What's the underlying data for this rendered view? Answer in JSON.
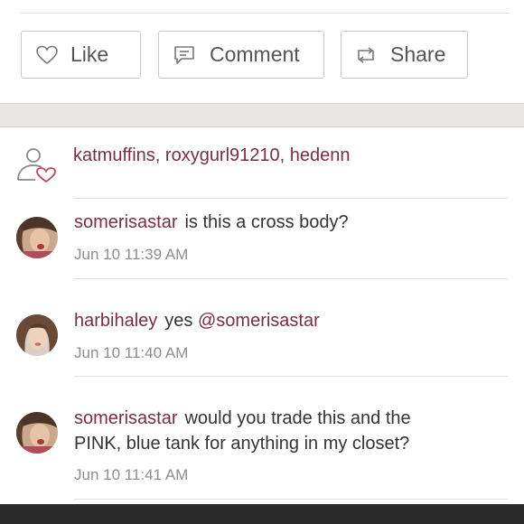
{
  "actions": {
    "like_label": "Like",
    "comment_label": "Comment",
    "share_label": "Share"
  },
  "likers": {
    "names": [
      "katmuffins",
      "roxygurl91210",
      "hedenn"
    ]
  },
  "comments": [
    {
      "user": "somerisastar",
      "text": "is this a cross body?",
      "time": "Jun 10 11:39 AM"
    },
    {
      "user": "harbihaley",
      "text": "yes",
      "mention": "@somerisastar",
      "time": "Jun 10 11:40 AM"
    },
    {
      "user": "somerisastar",
      "text_line1": "would you trade this and the",
      "text_line2": "PINK, blue tank for anything in my closet?",
      "time": "Jun 10 11:41 AM"
    }
  ],
  "colors": {
    "username": "#7a2e42",
    "heart_accent": "#c0485e",
    "border": "#c9c9c9"
  }
}
